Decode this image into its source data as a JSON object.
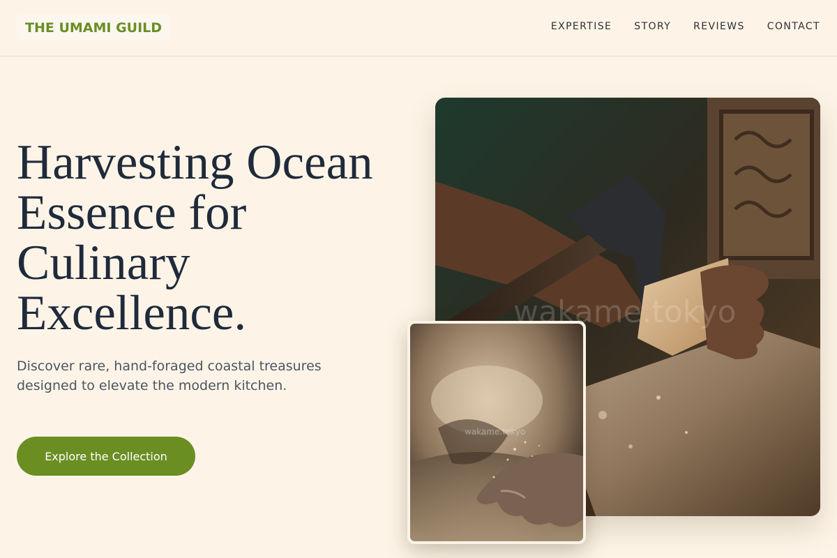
{
  "brand": {
    "name": "THE UMAMI GUILD"
  },
  "nav": {
    "items": [
      {
        "label": "EXPERTISE"
      },
      {
        "label": "STORY"
      },
      {
        "label": "REVIEWS"
      },
      {
        "label": "CONTACT"
      }
    ]
  },
  "hero": {
    "title": "Harvesting Ocean Essence for Culinary Excellence.",
    "subtitle": "Discover rare, hand-foraged coastal treasures designed to elevate the modern kitchen.",
    "cta_label": "Explore the Collection"
  },
  "images": {
    "main_watermark": "wakame.tokyo",
    "inset_watermark": "wakame.tokyo"
  },
  "colors": {
    "background": "#fdf4e7",
    "accent": "#6b8e23",
    "heading": "#1f2a3a",
    "body_text": "#4a5563"
  }
}
